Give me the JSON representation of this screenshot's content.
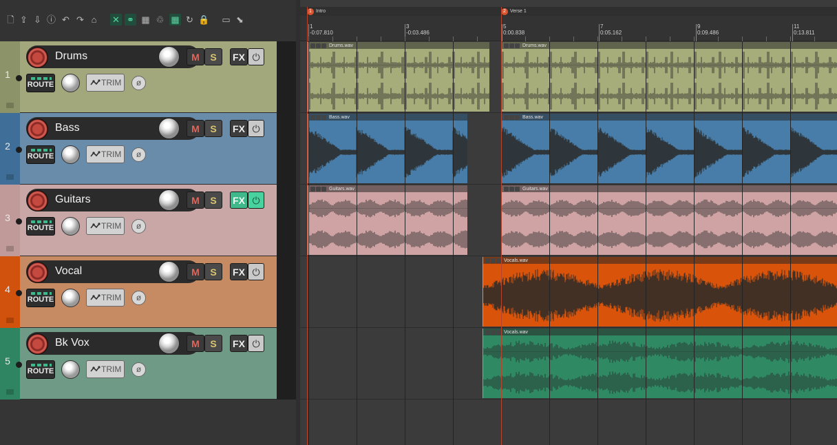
{
  "toolbar": {
    "icons": [
      "new-project-icon",
      "open-project-icon",
      "save-project-icon",
      "project-settings-icon",
      "undo-icon",
      "redo-icon",
      "metronome-icon",
      "ripple-edit-icon",
      "grouping-icon",
      "snap-grid-icon",
      "envelope-link-icon",
      "grid-icon",
      "auto-crossfade-icon",
      "lock-icon",
      "color-icon",
      "marker-tool-icon"
    ]
  },
  "ruler": {
    "labels": [
      {
        "bar": "1",
        "time": "-0:07.810"
      },
      {
        "bar": "3",
        "time": "-0:03.486"
      },
      {
        "bar": "5",
        "time": "0:00.838"
      },
      {
        "bar": "7",
        "time": "0:05.162"
      },
      {
        "bar": "9",
        "time": "0:09.486"
      },
      {
        "bar": "11",
        "time": "0:13.811"
      }
    ]
  },
  "markers": [
    {
      "num": "1",
      "label": "Intro"
    },
    {
      "num": "2",
      "label": "Verse 1"
    }
  ],
  "tracks": [
    {
      "num": "1",
      "name": "Drums",
      "color": "#a3a87c",
      "strip": "#8d9368",
      "fx_active": false
    },
    {
      "num": "2",
      "name": "Bass",
      "color": "#6a8cab",
      "strip": "#3f6f98",
      "fx_active": false
    },
    {
      "num": "3",
      "name": "Guitars",
      "color": "#c9a7a6",
      "strip": "#bf9a99",
      "fx_active": true
    },
    {
      "num": "4",
      "name": "Vocal",
      "color": "#c68b62",
      "strip": "#d1520c",
      "fx_active": false
    },
    {
      "num": "5",
      "name": "Bk Vox",
      "color": "#6f9a86",
      "strip": "#2f8461",
      "fx_active": false
    }
  ],
  "buttons": {
    "mute": "M",
    "solo": "S",
    "fx": "FX",
    "route": "ROUTE",
    "trim": "TRIM",
    "phase": "ø"
  },
  "items": [
    {
      "track": 0,
      "name": "Drums.wav",
      "color": "#a7ad7a"
    },
    {
      "track": 0,
      "name": "Drums.wav",
      "color": "#a7ad7a"
    },
    {
      "track": 1,
      "name": "Bass.wav",
      "color": "#477da8"
    },
    {
      "track": 1,
      "name": "Bass.wav",
      "color": "#477da8"
    },
    {
      "track": 2,
      "name": "Guitars.wav",
      "color": "#cfa3a3"
    },
    {
      "track": 2,
      "name": "Guitars.wav",
      "color": "#cfa3a3"
    },
    {
      "track": 3,
      "name": "Vocals.wav",
      "color": "#d9530a"
    },
    {
      "track": 4,
      "name": "Vocals.wav",
      "color": "#2f8a64"
    }
  ]
}
